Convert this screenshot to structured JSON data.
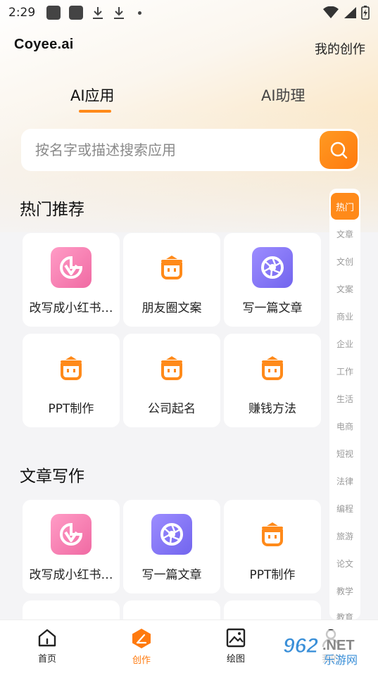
{
  "status_bar": {
    "time": "2:29"
  },
  "header": {
    "logo": "Coyee.ai",
    "my_works": "我的创作"
  },
  "tabs": [
    {
      "label": "AI应用",
      "active": true
    },
    {
      "label": "AI助理",
      "active": false
    }
  ],
  "search": {
    "placeholder": "按名字或描述搜索应用",
    "value": ""
  },
  "sections": [
    {
      "title": "热门推荐",
      "items": [
        {
          "label": "改写成小红书…",
          "icon": "xiaohongshu-icon"
        },
        {
          "label": "朋友圈文案",
          "icon": "robot-icon"
        },
        {
          "label": "写一篇文章",
          "icon": "aperture-icon"
        },
        {
          "label": "PPT制作",
          "icon": "robot-icon"
        },
        {
          "label": "公司起名",
          "icon": "robot-icon"
        },
        {
          "label": "赚钱方法",
          "icon": "robot-icon"
        }
      ]
    },
    {
      "title": "文章写作",
      "items": [
        {
          "label": "改写成小红书…",
          "icon": "xiaohongshu-icon"
        },
        {
          "label": "写一篇文章",
          "icon": "aperture-icon"
        },
        {
          "label": "PPT制作",
          "icon": "robot-icon"
        }
      ]
    }
  ],
  "categories": [
    "热门",
    "文章",
    "文创",
    "文案",
    "商业",
    "企业",
    "工作",
    "生活",
    "电商",
    "短视",
    "法律",
    "编程",
    "旅游",
    "论文",
    "教学",
    "教育"
  ],
  "bottom_nav": [
    {
      "label": "首页",
      "icon": "home-icon",
      "active": false
    },
    {
      "label": "创作",
      "icon": "create-icon",
      "active": true
    },
    {
      "label": "绘图",
      "icon": "image-icon",
      "active": false
    },
    {
      "label": "我的",
      "icon": "user-icon",
      "active": false
    }
  ],
  "watermark": {
    "text_main": "962",
    "text_suffix": ".NET",
    "text_sub": "乐游网"
  },
  "colors": {
    "accent": "#ff8a1a",
    "pink": "#f06aa3",
    "purple": "#7265ee"
  }
}
